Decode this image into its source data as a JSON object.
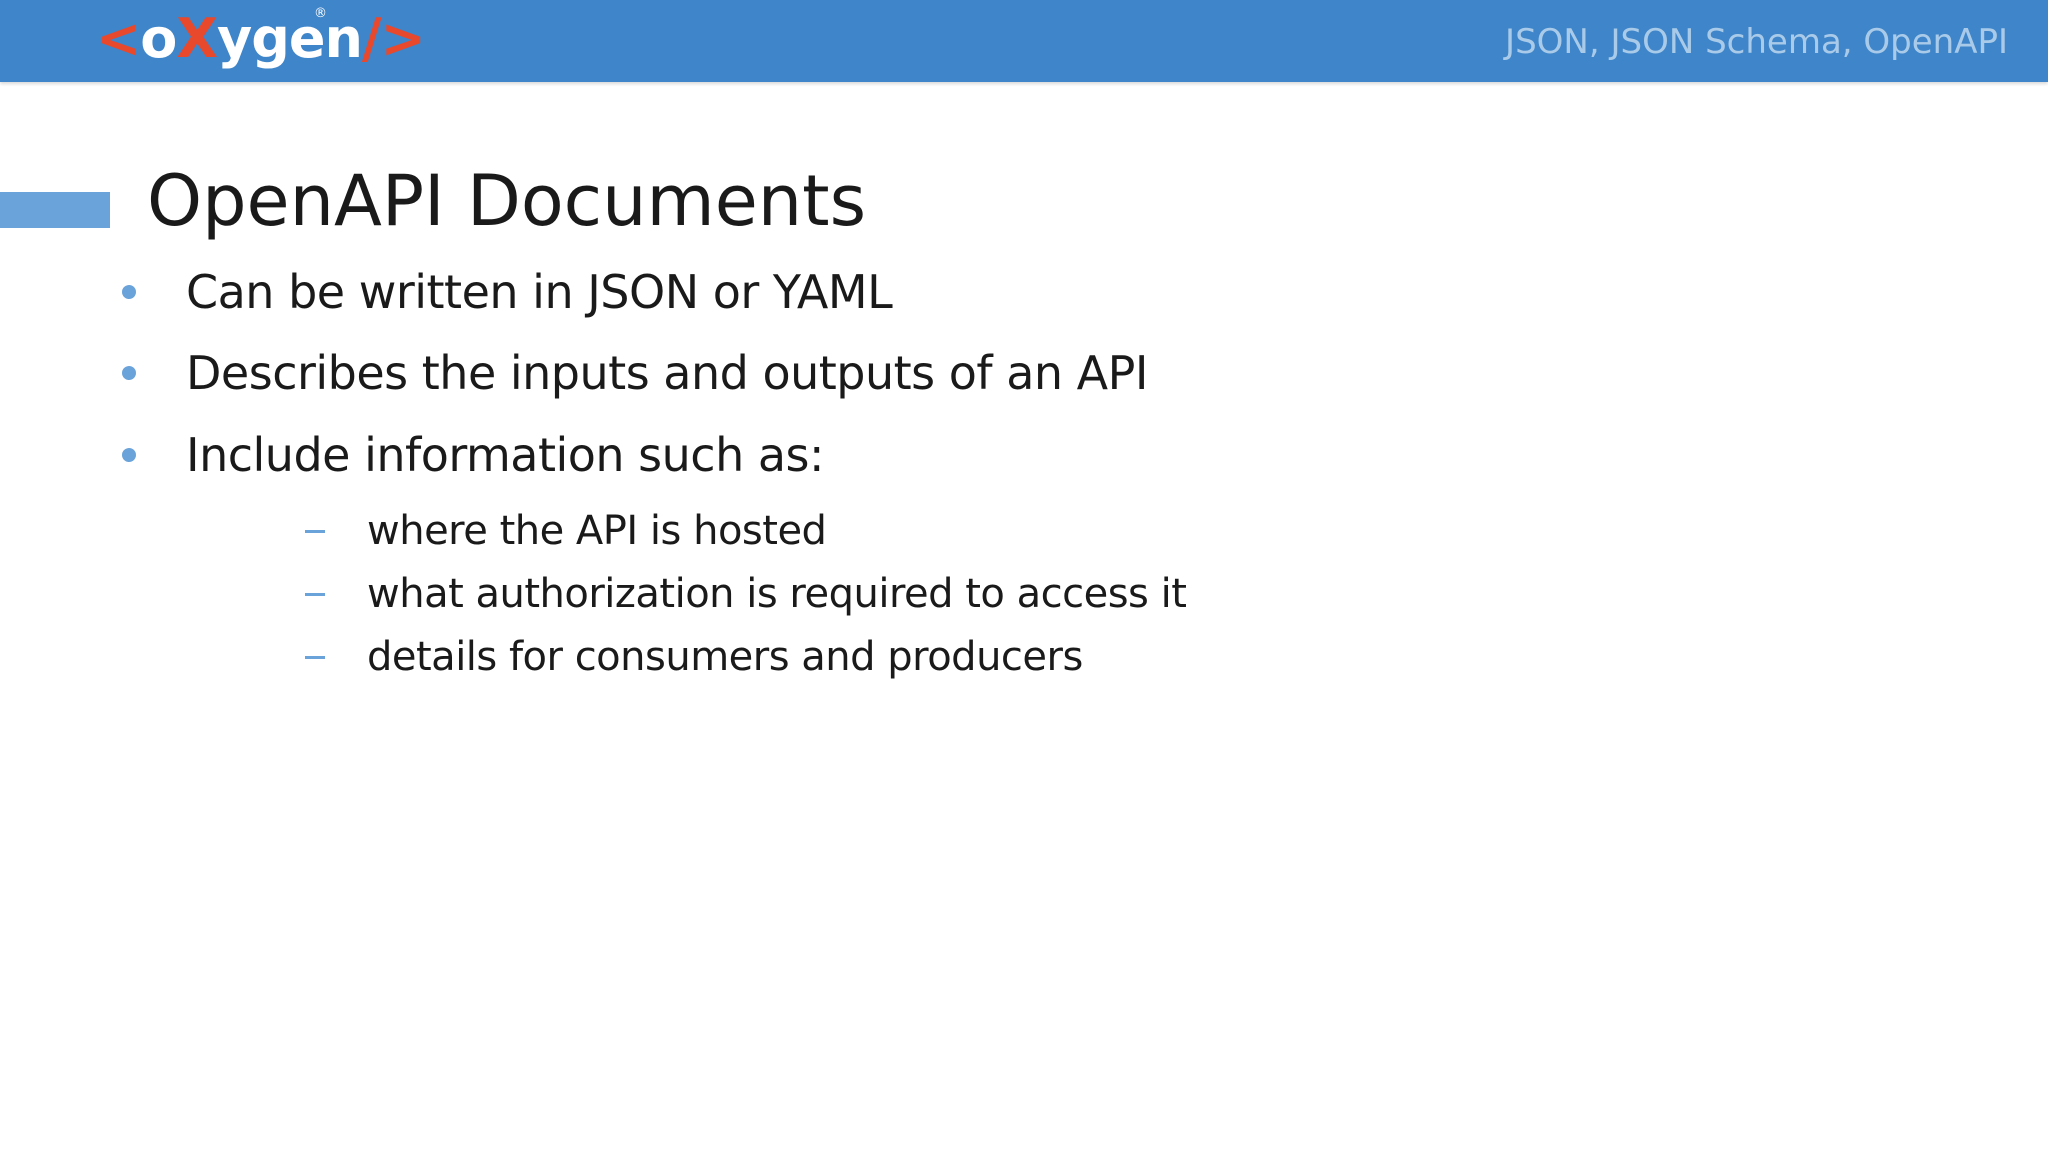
{
  "header": {
    "logo": {
      "open_bracket": "<",
      "part1": "o",
      "x": "X",
      "part2": "ygen",
      "close_bracket": "/>",
      "registered": "®"
    },
    "subtitle": "JSON, JSON Schema, OpenAPI",
    "colors": {
      "bar": "#3f85c9",
      "logo_accent": "#e8482c",
      "subtitle": "#a9cbe9"
    }
  },
  "slide": {
    "title": "OpenAPI Documents",
    "accent_color": "#6aa3d9",
    "bullets": [
      {
        "text": "Can be written in JSON or YAML"
      },
      {
        "text": "Describes the inputs and outputs of an API"
      },
      {
        "text": "Include information such as:"
      }
    ],
    "sub_bullets": [
      {
        "text": "where the API is hosted"
      },
      {
        "text": "what authorization is required to access it"
      },
      {
        "text": "details for consumers and producers"
      }
    ]
  }
}
